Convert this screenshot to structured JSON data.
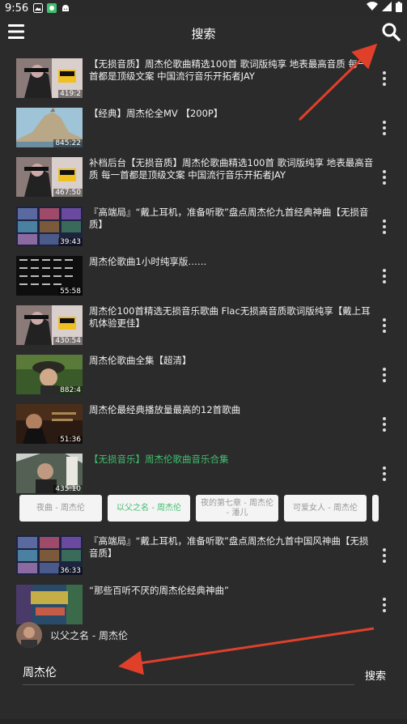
{
  "status": {
    "time": "9:56"
  },
  "header": {
    "title": "搜索"
  },
  "results": [
    {
      "title": "【无损音质】周杰伦歌曲精选100首 歌词版纯享 地表最高音质 每一首都是顶级文案 中国流行音乐开拓者JAY",
      "duration": "419:2",
      "thumb_badge": "Hi-Res AUDIO",
      "highlighted": false
    },
    {
      "title": "【经典】周杰伦全MV 【200P】",
      "duration": "845:22",
      "thumb_badge": "",
      "highlighted": false
    },
    {
      "title": "补档后台【无损音质】周杰伦歌曲精选100首 歌词版纯享 地表最高音质 每一首都是顶级文案 中国流行音乐开拓者JAY",
      "duration": "467:50",
      "thumb_badge": "Hi-Res AUDIO",
      "highlighted": false
    },
    {
      "title": "『高端局』“戴上耳机，准备听歌”盘点周杰伦九首经典神曲【无损音质】",
      "duration": "39:43",
      "thumb_badge": "",
      "highlighted": false
    },
    {
      "title": "周杰伦歌曲1小时纯享版……",
      "duration": "55:58",
      "thumb_badge": "",
      "highlighted": false
    },
    {
      "title": "周杰伦100首精选无损音乐歌曲 Flac无损高音质歌词版纯享【戴上耳机体验更佳】",
      "duration": "430:54",
      "thumb_badge": "Hi-Res AUDIO",
      "highlighted": false
    },
    {
      "title": "周杰伦歌曲全集【超清】",
      "duration": "882:4",
      "thumb_badge": "",
      "highlighted": false
    },
    {
      "title": "周杰伦最经典播放量最高的12首歌曲",
      "duration": "51:36",
      "thumb_badge": "",
      "highlighted": false
    },
    {
      "title": "【无损音乐】周杰伦歌曲音乐合集",
      "duration": "435:10",
      "thumb_badge": "",
      "highlighted": true
    }
  ],
  "chips": [
    {
      "label": "夜曲 - 周杰伦",
      "active": false
    },
    {
      "label": "以父之名 - 周杰伦",
      "active": true
    },
    {
      "label": "夜的第七章 - 周杰伦 - 潘儿",
      "active": false
    },
    {
      "label": "可爱女人 - 周杰伦",
      "active": false
    }
  ],
  "results2": [
    {
      "title": "『高端局』“戴上耳机，准备听歌”盘点周杰伦九首中国风神曲【无损音质】",
      "duration": "36:33",
      "thumb_badge": ""
    },
    {
      "title": "“那些百听不厌的周杰伦经典神曲”",
      "duration": "",
      "thumb_badge": "周杰伦 经典合集"
    }
  ],
  "history": {
    "label": "以父之名 - 周杰伦"
  },
  "search": {
    "value": "周杰伦",
    "button_label": "搜索"
  },
  "colors": {
    "background": "#2b2b2b",
    "accent_green": "#3fbf6f",
    "arrow_red": "#e0402a"
  }
}
